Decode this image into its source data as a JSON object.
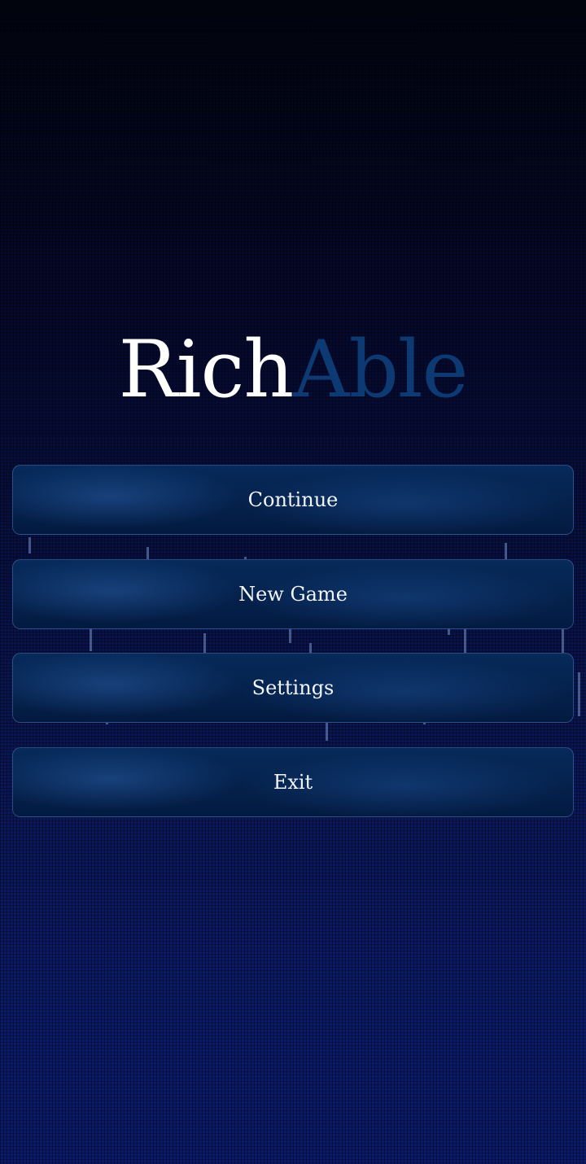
{
  "title": {
    "part1": "Rich",
    "part2": "Able"
  },
  "menu": {
    "continue": "Continue",
    "new_game": "New Game",
    "settings": "Settings",
    "exit": "Exit"
  },
  "colors": {
    "title_primary": "#ffffff",
    "title_accent": "#0d3a72",
    "button_bg": "#062a5a"
  }
}
